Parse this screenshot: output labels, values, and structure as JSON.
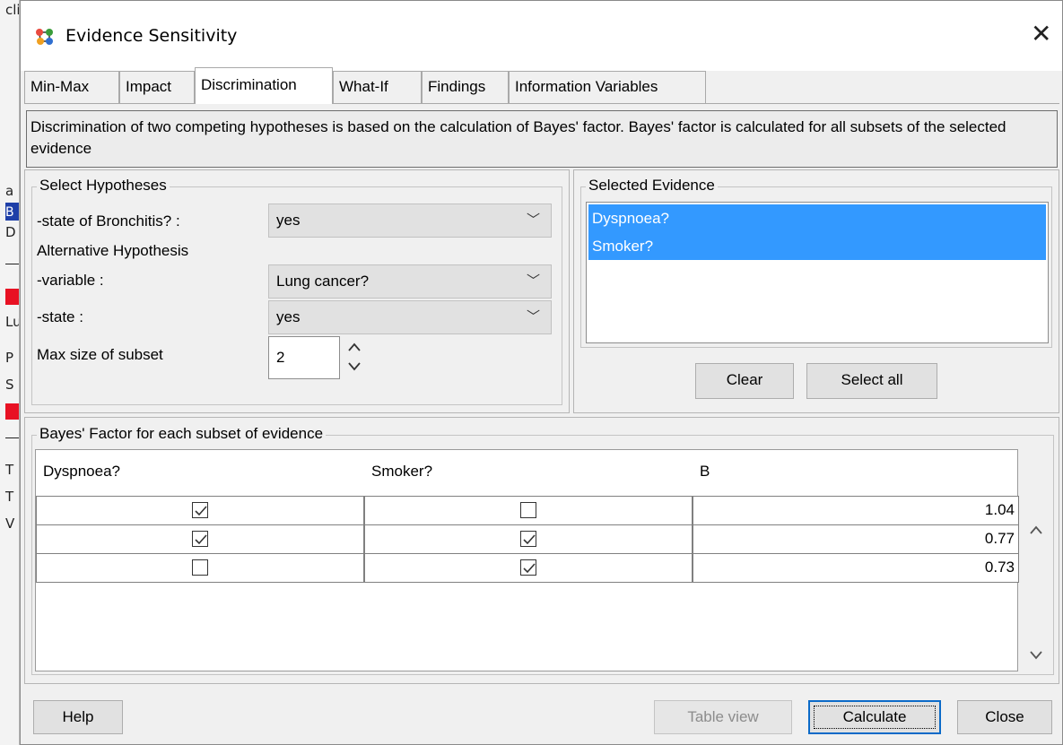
{
  "background_app": {
    "letters": [
      "cli",
      "a",
      "B",
      "D",
      "Lu",
      "P",
      "S",
      "T",
      "T",
      "V"
    ]
  },
  "dialog": {
    "title": "Evidence Sensitivity",
    "close_symbol": "✕"
  },
  "tabs": [
    {
      "label": "Min-Max"
    },
    {
      "label": "Impact"
    },
    {
      "label": "Discrimination"
    },
    {
      "label": "What-If"
    },
    {
      "label": "Findings"
    },
    {
      "label": "Information Variables"
    }
  ],
  "active_tab": "Discrimination",
  "description": "Discrimination of two competing hypotheses is based on the calculation of Bayes' factor. Bayes' factor is calculated for all subsets of the selected evidence",
  "select_hypotheses": {
    "legend": "Select Hypotheses",
    "state_label": "-state of Bronchitis? :",
    "state_value": "yes",
    "alternative_label": "Alternative Hypothesis",
    "variable_label": "-variable :",
    "variable_value": "Lung cancer?",
    "alt_state_label": "-state  :",
    "alt_state_value": "yes",
    "max_subset_label": "Max size of subset",
    "max_subset_value": "2"
  },
  "selected_evidence": {
    "legend": "Selected Evidence",
    "items": [
      "Dyspnoea?",
      "Smoker?"
    ],
    "clear_label": "Clear",
    "select_all_label": "Select all"
  },
  "bayes_table": {
    "legend": "Bayes' Factor for each subset of evidence",
    "columns": [
      "Dyspnoea?",
      "Smoker?",
      "B"
    ],
    "rows": [
      {
        "dyspnoea": true,
        "smoker": false,
        "b": "1.04"
      },
      {
        "dyspnoea": true,
        "smoker": true,
        "b": "0.77"
      },
      {
        "dyspnoea": false,
        "smoker": true,
        "b": "0.73"
      }
    ]
  },
  "footer": {
    "help_label": "Help",
    "table_view_label": "Table view",
    "calculate_label": "Calculate",
    "close_label": "Close"
  },
  "colors": {
    "selection": "#3399ff",
    "focus_border": "#0b6ac8",
    "alert_red": "#e81123"
  },
  "icons": {
    "app": "network-nodes-icon",
    "combo_arrow": "chevron-down-icon",
    "spin_up": "chevron-up-icon",
    "spin_down": "chevron-down-icon",
    "scroll_up": "chevron-up-icon",
    "scroll_down": "chevron-down-icon",
    "check": "checkmark-icon"
  }
}
